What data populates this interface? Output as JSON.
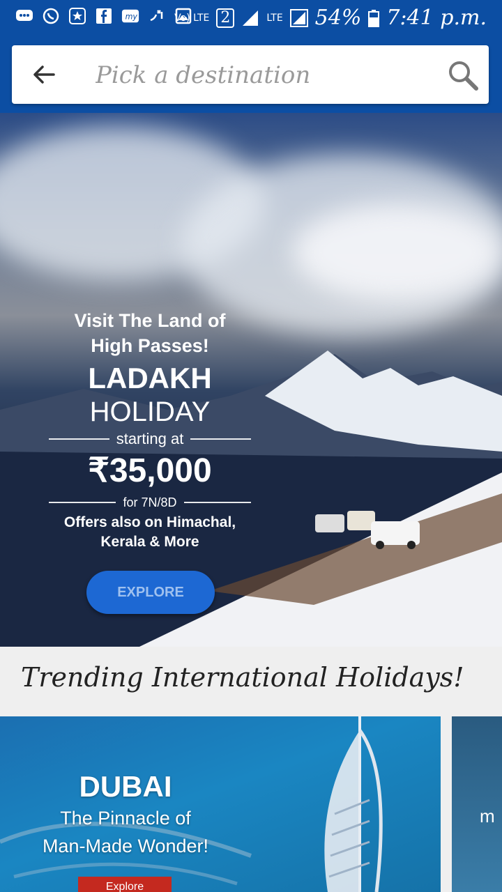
{
  "status_bar": {
    "lte_label": "LTE",
    "volte_label": "Vo) LTE",
    "sim_label": "2",
    "battery": "54%",
    "time": "7:41 p.m."
  },
  "search": {
    "placeholder": "Pick a destination"
  },
  "hero": {
    "line1": "Visit The Land of",
    "line2": "High Passes!",
    "title": "LADAKH",
    "subtitle": "HOLIDAY",
    "starting": "starting at",
    "price": "₹35,000",
    "duration": "for 7N/8D",
    "offer1": "Offers also on Himachal,",
    "offer2": "Kerala & More",
    "cta": "EXPLORE"
  },
  "section": {
    "title": "Trending International Holidays!"
  },
  "cards": [
    {
      "title": "DUBAI",
      "subtitle1": "The Pinnacle of",
      "subtitle2": "Man-Made Wonder!",
      "cta": "Explore"
    },
    {
      "partial_text": "m"
    }
  ],
  "colors": {
    "header": "#0c4ea3",
    "cta_blue": "#1d68d3",
    "cta_red": "#c4291f"
  }
}
